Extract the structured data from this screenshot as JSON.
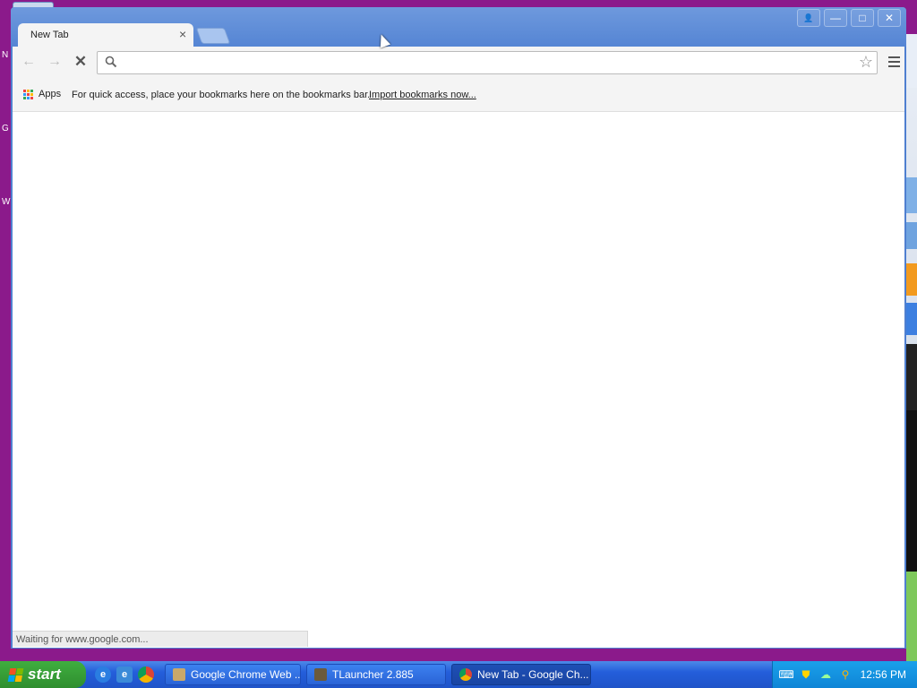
{
  "browser": {
    "tab_title": "New Tab",
    "tab_close": "×",
    "omnibox_value": "",
    "bookmarks_apps_label": "Apps",
    "bookmarks_hint": "For quick access, place your bookmarks here on the bookmarks bar.",
    "bookmarks_import_link": "Import bookmarks now...",
    "status_text": "Waiting for www.google.com..."
  },
  "window_controls": {
    "minimize": "—",
    "maximize": "□",
    "close": "✕",
    "profile": "👤"
  },
  "taskbar": {
    "start_label": "start",
    "tasks": [
      {
        "label": "Google Chrome Web ...",
        "active": false
      },
      {
        "label": "TLauncher 2.885",
        "active": false
      },
      {
        "label": "New Tab - Google Ch...",
        "active": true
      }
    ],
    "clock": "12:56 PM"
  },
  "desktop_letters": [
    "N",
    "G",
    "W"
  ],
  "colors": {
    "desktop": "#8b1a8b",
    "titlebar": "#5585d4",
    "taskbar": "#245edb",
    "start": "#3fae3f",
    "tray": "#0f85d6"
  }
}
